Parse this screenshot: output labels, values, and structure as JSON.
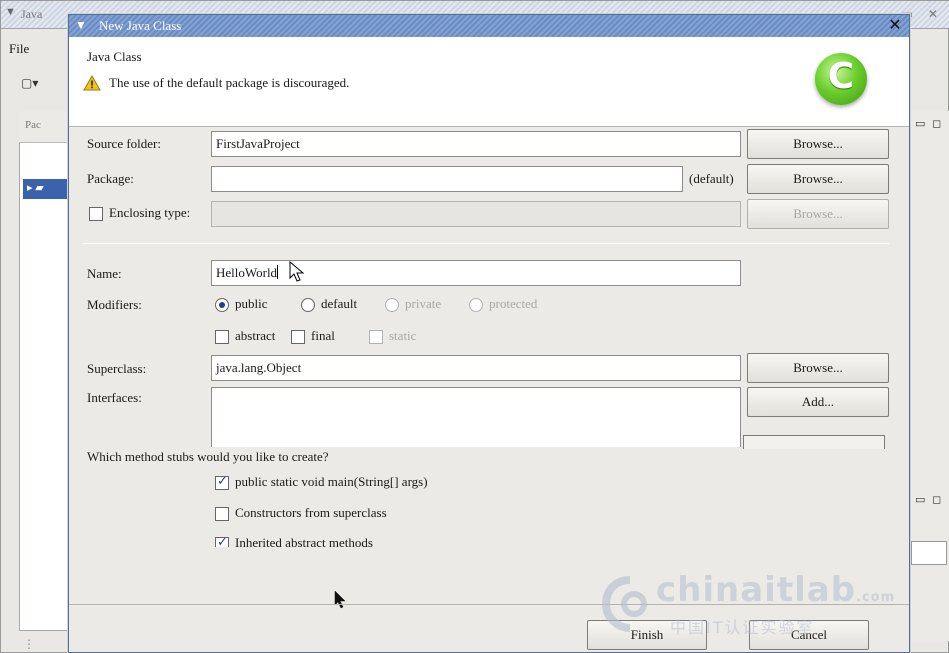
{
  "ide": {
    "title": "Java",
    "menu_file": "File",
    "pane_tab": "Pac"
  },
  "dialog": {
    "title": "New Java Class",
    "banner_title": "Java Class",
    "banner_message": "The use of the default package is discouraged.",
    "logo_letter": "C",
    "source_folder_label": "Source folder:",
    "source_folder_value": "FirstJavaProject",
    "package_label": "Package:",
    "package_value": "",
    "package_hint": "(default)",
    "enclosing_type_label": "Enclosing type:",
    "enclosing_type_value": "",
    "enclosing_type_checked": false,
    "browse_label": "Browse...",
    "name_label": "Name:",
    "name_value": "HelloWorld",
    "modifiers_label": "Modifiers:",
    "modifiers_access": [
      {
        "label": "public",
        "selected": true,
        "enabled": true
      },
      {
        "label": "default",
        "selected": false,
        "enabled": true
      },
      {
        "label": "private",
        "selected": false,
        "enabled": false
      },
      {
        "label": "protected",
        "selected": false,
        "enabled": false
      }
    ],
    "modifiers_other": [
      {
        "label": "abstract",
        "checked": false,
        "enabled": true
      },
      {
        "label": "final",
        "checked": false,
        "enabled": true
      },
      {
        "label": "static",
        "checked": false,
        "enabled": false
      }
    ],
    "superclass_label": "Superclass:",
    "superclass_value": "java.lang.Object",
    "browse_superclass_label": "Browse...",
    "interfaces_label": "Interfaces:",
    "add_label": "Add...",
    "stubs_question": "Which method stubs would you like to create?",
    "stubs": [
      {
        "label": "public static void main(String[] args)",
        "checked": true
      },
      {
        "label": "Constructors from superclass",
        "checked": false
      },
      {
        "label": "Inherited abstract methods",
        "checked": true
      }
    ],
    "finish_label": "Finish",
    "cancel_label": "Cancel"
  },
  "watermark": {
    "text": "chinaitlab",
    "suffix": ".com",
    "subtitle": "中国IT认证实验室"
  },
  "colors": {
    "dialog_title_bar": "#6a8cc4",
    "selection": "#3b63ad",
    "logo_green": "#6bcf2c",
    "warning_yellow": "#f2c21b"
  }
}
